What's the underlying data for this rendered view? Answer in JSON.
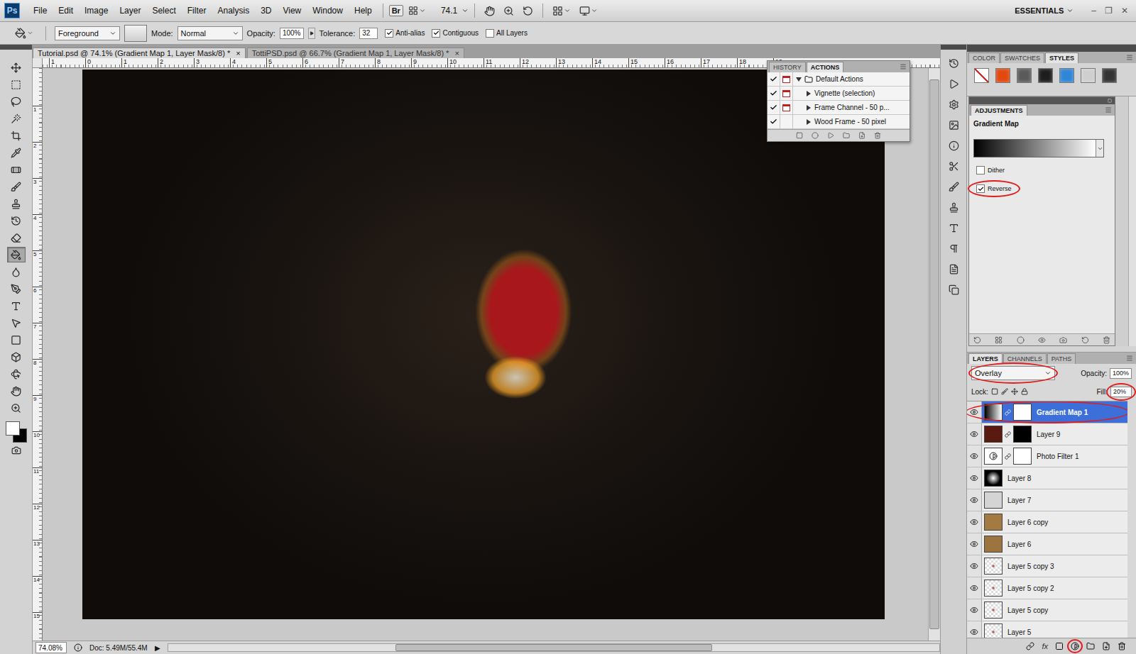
{
  "menu_bar": {
    "logo": "Ps",
    "items": [
      "File",
      "Edit",
      "Image",
      "Layer",
      "Select",
      "Filter",
      "Analysis",
      "3D",
      "View",
      "Window",
      "Help"
    ],
    "bridge": "Br",
    "zoom": "74.1",
    "workspace": "ESSENTIALS",
    "window_buttons": [
      "–",
      "❐",
      "✕"
    ]
  },
  "options_bar": {
    "preset": "Foreground",
    "mode_label": "Mode:",
    "mode": "Normal",
    "opacity_label": "Opacity:",
    "opacity": "100%",
    "tolerance_label": "Tolerance:",
    "tolerance": "32",
    "checks": [
      {
        "label": "Anti-alias",
        "checked": true
      },
      {
        "label": "Contiguous",
        "checked": true
      },
      {
        "label": "All Layers",
        "checked": false
      }
    ]
  },
  "tools": [
    {
      "selected": false
    },
    {
      "selected": false
    },
    {
      "selected": false
    },
    {
      "selected": false
    },
    {
      "selected": false
    },
    {
      "selected": false
    },
    {
      "selected": false
    },
    {
      "selected": false
    },
    {
      "selected": false
    },
    {
      "selected": false
    },
    {
      "selected": false
    },
    {
      "selected": true
    },
    {
      "selected": false
    },
    {
      "selected": false
    },
    {
      "selected": false
    },
    {
      "selected": false
    },
    {
      "selected": false
    },
    {
      "selected": false
    },
    {
      "selected": false
    },
    {
      "selected": false
    },
    {
      "selected": false
    }
  ],
  "colors": {
    "foreground": "#ffffff",
    "background": "#000000"
  },
  "document_tabs": [
    {
      "label": "Tutorial.psd @ 74.1% (Gradient Map 1, Layer Mask/8) *",
      "selected": true,
      "close": "×"
    },
    {
      "label": "TottiPSD.psd @ 66.7% (Gradient Map 1, Layer Mask/8) *",
      "selected": false,
      "close": "×"
    }
  ],
  "rulers": {
    "top": [
      "1",
      "0",
      "1",
      "2",
      "3",
      "4",
      "5",
      "6",
      "7",
      "8",
      "9",
      "10",
      "11",
      "12",
      "13",
      "14",
      "15",
      "16",
      "17",
      "18",
      "19"
    ],
    "left": [
      "1",
      "2",
      "3",
      "4",
      "5",
      "6",
      "7",
      "8",
      "9",
      "10",
      "11",
      "12",
      "13",
      "14",
      "15"
    ]
  },
  "history_panel": {
    "tabs": [
      {
        "label": "HISTORY",
        "selected": false
      },
      {
        "label": "ACTIONS",
        "selected": true
      }
    ],
    "rows": [
      {
        "label": "Default Actions",
        "kind": "set",
        "expanded": true,
        "checked": true,
        "dialog": true
      },
      {
        "label": "Vignette (selection)",
        "kind": "action",
        "expanded": false,
        "checked": true,
        "dialog": true
      },
      {
        "label": "Frame Channel - 50 p...",
        "kind": "action",
        "expanded": false,
        "checked": true,
        "dialog": true
      },
      {
        "label": "Wood Frame - 50 pixel",
        "kind": "action",
        "expanded": false,
        "checked": true,
        "dialog": false
      }
    ]
  },
  "styles_panel": {
    "tabs": [
      {
        "label": "COLOR",
        "selected": false
      },
      {
        "label": "SWATCHES",
        "selected": false
      },
      {
        "label": "STYLES",
        "selected": true
      }
    ],
    "swatches": [
      {
        "kind": "none",
        "color": "#ffffff"
      },
      {
        "kind": "style",
        "color": "#e2480f"
      },
      {
        "kind": "style",
        "color": "#5a5a5a"
      },
      {
        "kind": "style",
        "color": "#1e1e1e"
      },
      {
        "kind": "style",
        "color": "#2f86d6"
      },
      {
        "kind": "style",
        "color": "#cfcfcf"
      },
      {
        "kind": "style",
        "color": "#333333"
      }
    ]
  },
  "adjustments_panel": {
    "title": "ADJUSTMENTS",
    "name": "Gradient Map",
    "gradient": [
      "#000000",
      "#ffffff"
    ],
    "options": [
      {
        "label": "Dither",
        "checked": false,
        "circled": false
      },
      {
        "label": "Reverse",
        "checked": true,
        "circled": true
      }
    ]
  },
  "layers_panel": {
    "tabs": [
      {
        "label": "LAYERS",
        "selected": true
      },
      {
        "label": "CHANNELS",
        "selected": false
      },
      {
        "label": "PATHS",
        "selected": false
      }
    ],
    "blend_mode": "Overlay",
    "blend_circled": true,
    "opacity_label": "Opacity:",
    "opacity": "100%",
    "lock_label": "Lock:",
    "fill_label": "Fill:",
    "fill": "20%",
    "fill_circled": true,
    "layers": [
      {
        "name": "Gradient Map 1",
        "kind": "gradient",
        "thumb": "#000000",
        "mask": "#ffffff",
        "visible": true,
        "selected": true,
        "circled": true
      },
      {
        "name": "Layer 9",
        "kind": "pixel",
        "thumb": "#5a1a10",
        "mask": "#000000",
        "visible": true,
        "selected": false,
        "circled": false
      },
      {
        "name": "Photo Filter 1",
        "kind": "adjustment",
        "thumb": "#ffffff",
        "mask": "#ffffff",
        "visible": true,
        "selected": false,
        "circled": false
      },
      {
        "name": "Layer 8",
        "kind": "glow",
        "thumb": "#000000",
        "mask": null,
        "visible": true,
        "selected": false,
        "circled": false
      },
      {
        "name": "Layer 7",
        "kind": "pixel",
        "thumb": "#d4d4d4",
        "mask": null,
        "visible": true,
        "selected": false,
        "circled": false
      },
      {
        "name": "Layer 6 copy",
        "kind": "pixel",
        "thumb": "#a27a42",
        "mask": null,
        "visible": true,
        "selected": false,
        "circled": false
      },
      {
        "name": "Layer 6",
        "kind": "pixel",
        "thumb": "#9c7440",
        "mask": null,
        "visible": true,
        "selected": false,
        "circled": false
      },
      {
        "name": "Layer 5 copy 3",
        "kind": "transparent",
        "thumb": "#c06060",
        "mask": null,
        "visible": true,
        "selected": false,
        "circled": false
      },
      {
        "name": "Layer 5 copy 2",
        "kind": "transparent",
        "thumb": "#c06060",
        "mask": null,
        "visible": true,
        "selected": false,
        "circled": false
      },
      {
        "name": "Layer 5 copy",
        "kind": "transparent",
        "thumb": "#c06060",
        "mask": null,
        "visible": true,
        "selected": false,
        "circled": false
      },
      {
        "name": "Layer 5",
        "kind": "transparent",
        "thumb": "#c06060",
        "mask": null,
        "visible": true,
        "selected": false,
        "circled": false
      }
    ],
    "fx_label": "fx",
    "footer_buttons": [
      {
        "circled": false
      },
      {
        "circled": false
      },
      {
        "circled": false
      },
      {
        "circled": true
      },
      {
        "circled": false
      },
      {
        "circled": false
      },
      {
        "circled": false
      }
    ]
  },
  "status_bar": {
    "zoom": "74.08%",
    "doc": "Doc: 5.49M/55.4M",
    "arrow": "▶"
  }
}
